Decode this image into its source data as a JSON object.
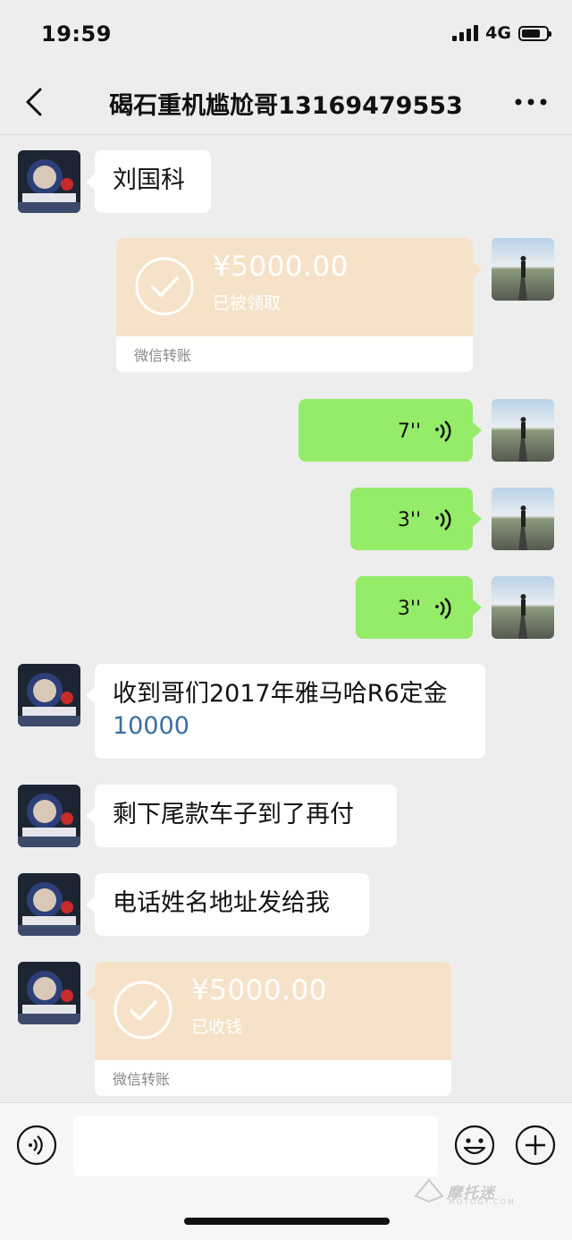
{
  "status_bar": {
    "time": "19:59",
    "network": "4G"
  },
  "header": {
    "title": "碣石重机尴尬哥13169479553",
    "back_icon": "chevron-left-icon",
    "more_icon": "more-dots-icon"
  },
  "messages": [
    {
      "side": "left",
      "type": "text",
      "text": "刘国科"
    },
    {
      "side": "right",
      "type": "transfer",
      "amount": "¥5000.00",
      "status": "已被领取",
      "footer": "微信转账"
    },
    {
      "side": "right",
      "type": "voice",
      "duration": "7''"
    },
    {
      "side": "right",
      "type": "voice",
      "duration": "3''"
    },
    {
      "side": "right",
      "type": "voice",
      "duration": "3''"
    },
    {
      "side": "left",
      "type": "text",
      "text_line1": "收到哥们2017年雅马哈R6定金",
      "text_line2": "10000"
    },
    {
      "side": "left",
      "type": "text",
      "text": "剩下尾款车子到了再付"
    },
    {
      "side": "left",
      "type": "text",
      "text": "电话姓名地址发给我"
    },
    {
      "side": "left",
      "type": "transfer",
      "amount": "¥5000.00",
      "status": "已收钱",
      "footer": "微信转账"
    }
  ],
  "input_bar": {
    "voice_icon": "voice-input-icon",
    "emoji_icon": "emoji-icon",
    "plus_icon": "plus-icon"
  },
  "watermark": {
    "text": "摩托迷",
    "sub": "MOTOGY.COM"
  },
  "colors": {
    "background": "#ededed",
    "self_bubble": "#95ec69",
    "other_bubble": "#ffffff",
    "transfer": "#f6e2c8",
    "link_number": "#3a6ea5"
  }
}
